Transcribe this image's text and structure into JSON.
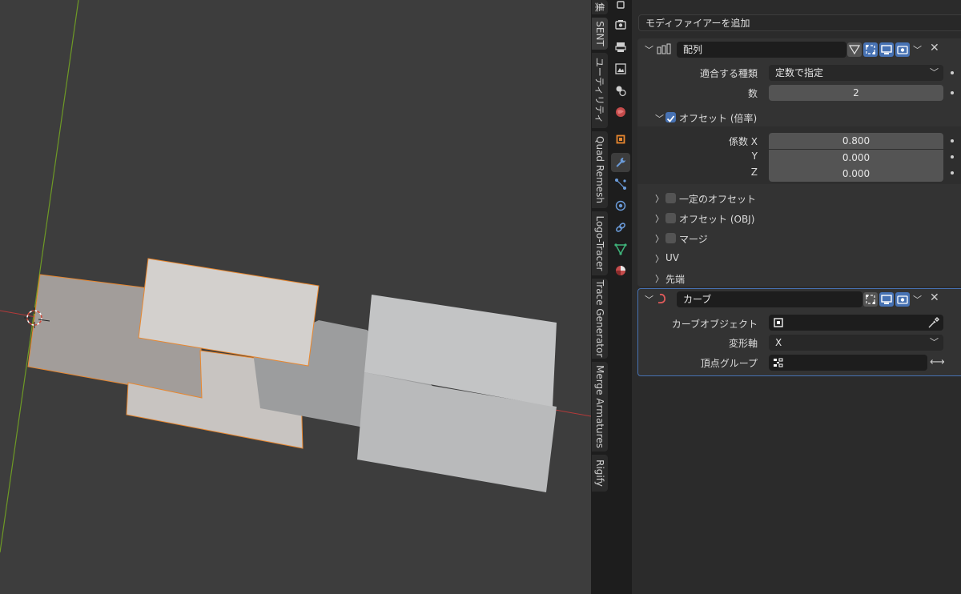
{
  "n_tabs": [
    {
      "label": "集"
    },
    {
      "label": "SENT"
    },
    {
      "label": "ユーティリティ"
    },
    {
      "label": "Quad Remesh"
    },
    {
      "label": "Logo-Tracer"
    },
    {
      "label": "Trace Generator"
    },
    {
      "label": "Merge Armatures"
    },
    {
      "label": "Rigify"
    }
  ],
  "properties_tabs": [
    {
      "icon": "tool-icon"
    },
    {
      "icon": "render-icon"
    },
    {
      "icon": "output-icon"
    },
    {
      "icon": "view-layer-icon"
    },
    {
      "icon": "scene-icon"
    },
    {
      "icon": "world-icon"
    },
    {
      "icon": "object-icon"
    },
    {
      "icon": "modifier-wrench-icon",
      "active": true
    },
    {
      "icon": "particles-icon"
    },
    {
      "icon": "physics-icon"
    },
    {
      "icon": "constraints-icon"
    },
    {
      "icon": "data-icon"
    },
    {
      "icon": "material-icon"
    }
  ],
  "add_modifier": {
    "label": "モディファイアーを追加"
  },
  "array_modifier": {
    "name": "配列",
    "fit_type": {
      "label": "適合する種類",
      "value": "定数で指定"
    },
    "count": {
      "label": "数",
      "value": "2"
    },
    "relative_offset": {
      "label": "オフセット (倍率)",
      "enabled": true
    },
    "factor_x": {
      "label": "係数 X",
      "value": "0.800"
    },
    "factor_y": {
      "label": "Y",
      "value": "0.000"
    },
    "factor_z": {
      "label": "Z",
      "value": "0.000"
    },
    "subpanels": {
      "constant_offset": {
        "label": "一定のオフセット",
        "enabled": false
      },
      "object_offset": {
        "label": "オフセット (OBJ)",
        "enabled": false
      },
      "merge": {
        "label": "マージ",
        "enabled": false
      },
      "uv": {
        "label": "UV"
      },
      "caps": {
        "label": "先端"
      }
    }
  },
  "curve_modifier": {
    "name": "カーブ",
    "curve_object": {
      "label": "カーブオブジェクト",
      "value": ""
    },
    "deform_axis": {
      "label": "変形軸",
      "value": "X"
    },
    "vertex_group": {
      "label": "頂点グループ",
      "value": ""
    }
  },
  "colors": {
    "accent": "#4772b3",
    "selection_outline": "#e8872f",
    "x_axis": "#b33a3a",
    "y_axis": "#6e9a25"
  }
}
